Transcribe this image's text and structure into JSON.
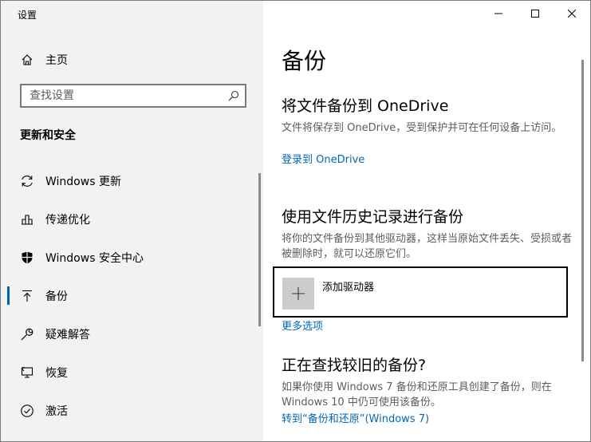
{
  "window": {
    "title": "设置"
  },
  "sidebar": {
    "home_label": "主页",
    "search_placeholder": "查找设置",
    "section_heading": "更新和安全",
    "items": [
      {
        "label": "Windows 更新",
        "icon": "refresh-icon"
      },
      {
        "label": "传递优化",
        "icon": "delivery-optimization-icon"
      },
      {
        "label": "Windows 安全中心",
        "icon": "shield-icon"
      },
      {
        "label": "备份",
        "icon": "backup-arrow-icon",
        "active": true
      },
      {
        "label": "疑难解答",
        "icon": "wrench-icon"
      },
      {
        "label": "恢复",
        "icon": "recovery-icon"
      },
      {
        "label": "激活",
        "icon": "check-circle-icon"
      }
    ]
  },
  "main": {
    "title": "备份",
    "onedrive": {
      "heading": "将文件备份到 OneDrive",
      "desc": "文件将保存到 OneDrive，受到保护并可在任何设备上访问。",
      "link": "登录到 OneDrive"
    },
    "file_history": {
      "heading": "使用文件历史记录进行备份",
      "desc": "将你的文件备份到其他驱动器，这样当原始文件丢失、受损或者被删除时，就可以还原它们。",
      "add_drive_label": "添加驱动器",
      "more_options": "更多选项"
    },
    "older_backup": {
      "heading": "正在查找较旧的备份?",
      "desc": "如果你使用 Windows 7 备份和还原工具创建了备份，则在 Windows 10 中仍可使用该备份。",
      "link": "转到“备份和还原”(Windows 7)"
    }
  },
  "colors": {
    "accent": "#0063b1",
    "link": "#0067b8",
    "sidebar_bg": "#f2f2f2"
  }
}
